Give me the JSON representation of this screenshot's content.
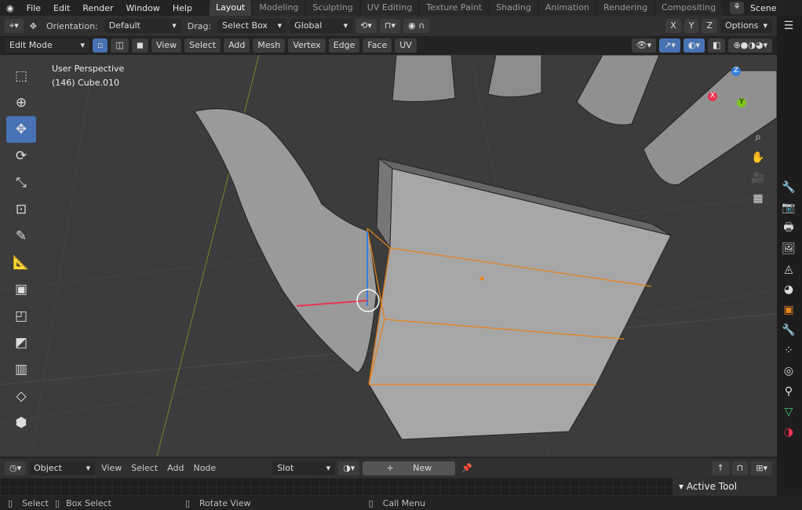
{
  "menu": [
    "File",
    "Edit",
    "Render",
    "Window",
    "Help"
  ],
  "workspaces": [
    "Layout",
    "Modeling",
    "Sculpting",
    "UV Editing",
    "Texture Paint",
    "Shading",
    "Animation",
    "Rendering",
    "Compositing"
  ],
  "scene": "Scene",
  "tool_header": {
    "orientation_label": "Orientation:",
    "orientation": "Default",
    "drag_label": "Drag:",
    "drag": "Select Box",
    "transform_orientation": "Global",
    "axes": [
      "X",
      "Y",
      "Z"
    ],
    "options": "Options"
  },
  "view_header": {
    "mode": "Edit Mode",
    "menus": [
      "View",
      "Select",
      "Add",
      "Mesh",
      "Vertex",
      "Edge",
      "Face",
      "UV"
    ]
  },
  "overlay": {
    "view_name": "User Perspective",
    "object": "(146) Cube.010"
  },
  "gizmo": {
    "x": "X",
    "y": "Y",
    "z": "Z",
    "x_color": "#e8344f",
    "y_color": "#7cc41c",
    "z_color": "#3b7ee0"
  },
  "shader_header": {
    "object": "Object",
    "menus": [
      "View",
      "Select",
      "Add",
      "Node"
    ],
    "slot": "Slot",
    "new": "New"
  },
  "active_tool": "Active Tool",
  "status": {
    "select": "Select",
    "box_select": "Box Select",
    "rotate": "Rotate View",
    "call_menu": "Call Menu"
  },
  "accent": "#4772b3",
  "selection_color": "#e8801a"
}
